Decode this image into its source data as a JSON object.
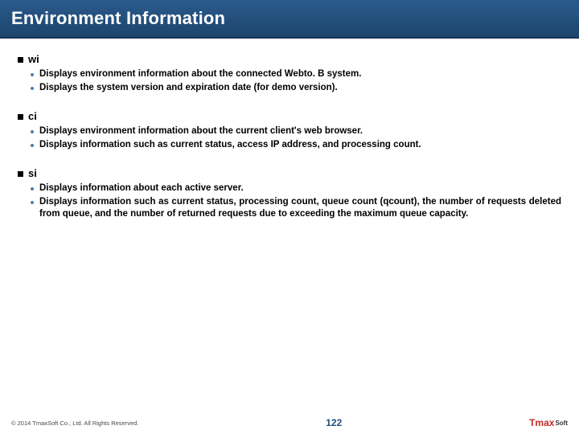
{
  "title": "Environment Information",
  "sections": [
    {
      "name": "wi",
      "items": [
        "Displays environment information about the connected Webto. B system.",
        "Displays the system version and expiration date (for demo version)."
      ]
    },
    {
      "name": "ci",
      "items": [
        "Displays environment information about the current client's web browser.",
        "Displays information such as current status, access IP address, and processing count."
      ]
    },
    {
      "name": "si",
      "items": [
        "Displays information about each active server.",
        "Displays information such as current status, processing count, queue count (qcount), the number of requests deleted from queue, and the number of returned requests due to exceeding the maximum queue capacity."
      ]
    }
  ],
  "footer": {
    "copyright": "© 2014 TmaxSoft Co., Ltd. All Rights Reserved.",
    "page": "122",
    "logo_main": "Tmax",
    "logo_sub": "Soft"
  }
}
